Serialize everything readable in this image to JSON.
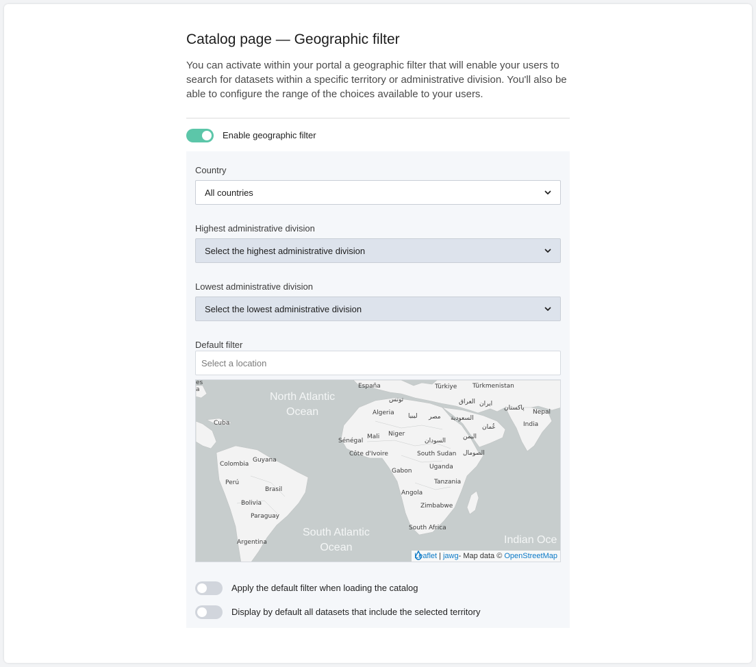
{
  "page": {
    "title": "Catalog page — Geographic filter",
    "description": "You can activate within your portal a geographic filter that will enable your users to search for datasets within a specific territory or administrative division. You'll also be able to configure the range of the choices available to your users."
  },
  "enable_filter": {
    "label": "Enable geographic filter",
    "enabled": true
  },
  "country": {
    "label": "Country",
    "value": "All countries"
  },
  "highest_division": {
    "label": "Highest administrative division",
    "value": "Select the highest administrative division"
  },
  "lowest_division": {
    "label": "Lowest administrative division",
    "value": "Select the lowest administrative division"
  },
  "default_filter": {
    "label": "Default filter",
    "placeholder": "Select a location"
  },
  "map": {
    "oceans": {
      "north_atlantic_1": "North Atlantic",
      "north_atlantic_2": "Ocean",
      "south_atlantic_1": "South Atlantic",
      "south_atlantic_2": "Ocean",
      "indian": "Indian Oce"
    },
    "places": {
      "espana": "España",
      "turkiye": "Türkiye",
      "turkmenistan": "Türkmenistan",
      "tunis": "تونس",
      "iraq": "العراق",
      "iran": "ایران",
      "algeria": "Algeria",
      "libya": "ليبيا",
      "egypt": "مصر",
      "saudi": "السعودية",
      "pakistan": "پاکستان",
      "nepal": "Nepal",
      "cuba": "Cuba",
      "oman": "عُمان",
      "india": "India",
      "mali": "Mali",
      "niger": "Niger",
      "senegal": "Sénégal",
      "sudan": "السودان",
      "yemen": "اليمن",
      "cote_divoire": "Côte d'Ivoire",
      "south_sudan": "South Sudan",
      "somalia": "الصومال",
      "guyana": "Guyana",
      "colombia": "Colombia",
      "gabon": "Gabon",
      "uganda": "Uganda",
      "peru": "Perú",
      "brasil": "Brasil",
      "tanzania": "Tanzania",
      "angola": "Angola",
      "bolivia": "Bolivia",
      "zimbabwe": "Zimbabwe",
      "paraguay": "Paraguay",
      "south_africa": "South Africa",
      "argentina": "Argentina",
      "frag_top": "es",
      "frag_a": "a"
    },
    "attribution": {
      "leaflet": "Leaflet",
      "sep": "|",
      "jawg": "jawg",
      "map_data": "- Map data ©",
      "osm": "OpenStreetMap"
    }
  },
  "options": {
    "apply_default": {
      "label": "Apply the default filter when loading the catalog",
      "enabled": false
    },
    "include_territory": {
      "label": "Display by default all datasets that include the selected territory",
      "enabled": false
    }
  },
  "colors": {
    "accent": "#5cc6a9",
    "toggle_off": "#d1d5dc",
    "panel_bg": "#f5f7fa",
    "select_disabled_bg": "#dde3ec",
    "map_water": "#c7cdcd",
    "map_land": "#f3f3f3",
    "link": "#0a79c7"
  }
}
